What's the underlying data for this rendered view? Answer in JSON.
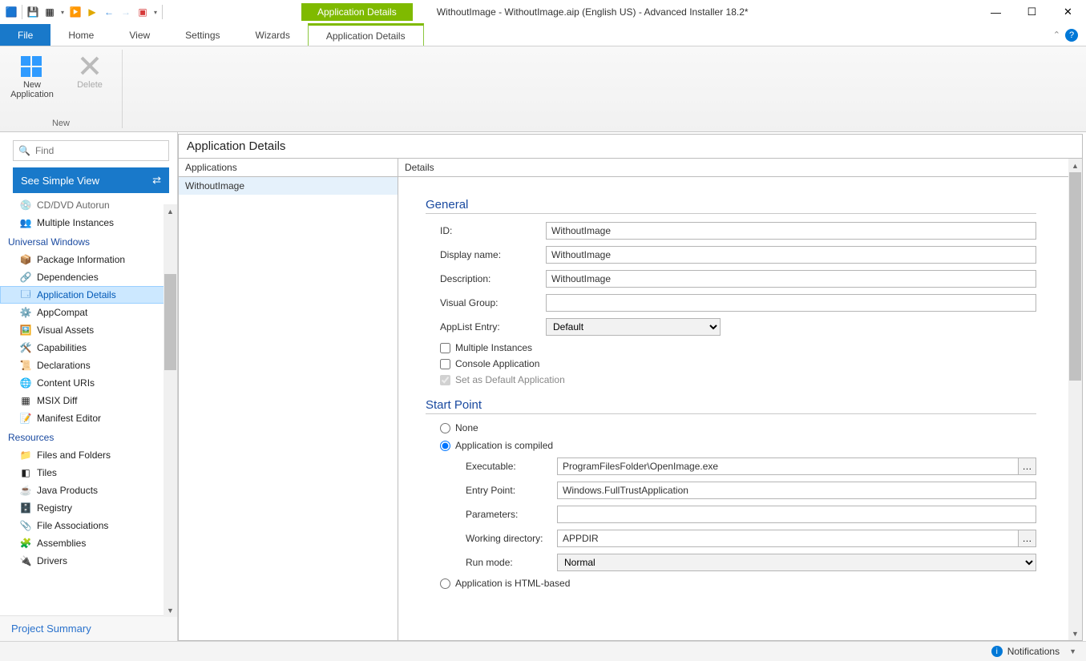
{
  "title": "WithoutImage - WithoutImage.aip (English US) - Advanced Installer 18.2*",
  "context_tab": "Application Details",
  "tabs": {
    "file": "File",
    "home": "Home",
    "view": "View",
    "settings": "Settings",
    "wizards": "Wizards",
    "appdetails": "Application Details"
  },
  "ribbon": {
    "new_app": "New\nApplication",
    "delete": "Delete",
    "group_new": "New"
  },
  "search_placeholder": "Find",
  "simple_view": "See Simple View",
  "nav": {
    "cdvd": "CD/DVD Autorun",
    "multi": "Multiple Instances",
    "cat_uw": "Universal Windows",
    "pkg": "Package Information",
    "dep": "Dependencies",
    "appd": "Application Details",
    "appc": "AppCompat",
    "vis": "Visual Assets",
    "cap": "Capabilities",
    "decl": "Declarations",
    "curis": "Content URIs",
    "msix": "MSIX Diff",
    "mani": "Manifest Editor",
    "cat_res": "Resources",
    "ff": "Files and Folders",
    "tiles": "Tiles",
    "java": "Java Products",
    "reg": "Registry",
    "fa": "File Associations",
    "asm": "Assemblies",
    "drv": "Drivers"
  },
  "project_summary": "Project Summary",
  "content_header": "Application Details",
  "col_apps": "Applications",
  "col_details": "Details",
  "app_selected": "WithoutImage",
  "general": {
    "title": "General",
    "id_lbl": "ID:",
    "id_val": "WithoutImage",
    "dn_lbl": "Display name:",
    "dn_val": "WithoutImage",
    "desc_lbl": "Description:",
    "desc_val": "WithoutImage",
    "vg_lbl": "Visual Group:",
    "vg_val": "",
    "al_lbl": "AppList Entry:",
    "al_val": "Default",
    "chk_multi": "Multiple Instances",
    "chk_console": "Console Application",
    "chk_default": "Set as Default Application"
  },
  "startpoint": {
    "title": "Start Point",
    "r_none": "None",
    "r_compiled": "Application is compiled",
    "exe_lbl": "Executable:",
    "exe_val": "ProgramFilesFolder\\OpenImage.exe",
    "ep_lbl": "Entry Point:",
    "ep_val": "Windows.FullTrustApplication",
    "par_lbl": "Parameters:",
    "par_val": "",
    "wd_lbl": "Working directory:",
    "wd_val": "APPDIR",
    "rm_lbl": "Run mode:",
    "rm_val": "Normal",
    "r_html": "Application is HTML-based"
  },
  "status": "Notifications"
}
